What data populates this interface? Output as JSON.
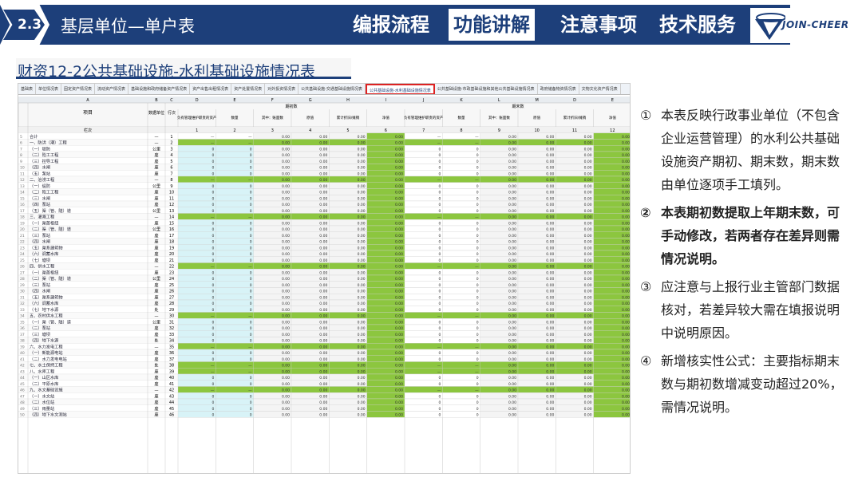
{
  "header": {
    "badge": "2.3",
    "title": "基层单位—单户表",
    "nav": [
      "编报流程",
      "功能讲解",
      "注意事项",
      "技术服务"
    ],
    "active_nav": 1,
    "logo": "JOIN-CHEER"
  },
  "section_title": "财资12-2公共基础设施-水利基础设施情况表",
  "tabs": [
    "基础表",
    "单位情况表",
    "固定资产情况表",
    "流动资产情况表",
    "基础设施和政府储备资产情况表",
    "资产出售出租情况表",
    "资产处置情况表",
    "对外投资情况表",
    "公共基础设施-交通基础设施情况表",
    "公共基础设施-水利基础设施情况表",
    "公共基础设施-市政基础设施和其他公共基础设施情况表",
    "政府储备物资情况表",
    "文物文化资产情况表"
  ],
  "selected_tab": 9,
  "col_letters": [
    "A",
    "B",
    "C",
    "D",
    "E",
    "F",
    "G",
    "H",
    "I",
    "J",
    "K",
    "L",
    "M"
  ],
  "col_group_labels": [
    "期初数",
    "期末数"
  ],
  "col_sub_labels": [
    "负有管理维护职责的资产",
    "数量",
    "其中：账面数",
    "原值",
    "累计折旧/摊销",
    "净值",
    "负有管理维护职责的资产",
    "数量",
    "其中：账面数",
    "原值",
    "累计折旧/摊销",
    "净值"
  ],
  "head_left": [
    "项目",
    "数据单位",
    "行次"
  ],
  "row_nums": [
    "栏次",
    "合计"
  ],
  "rows": [
    {
      "n": "5",
      "name": "合计",
      "unit": "—",
      "i": "1"
    },
    {
      "n": "6",
      "name": "一、防洪（潮）工程",
      "unit": "—",
      "i": "2",
      "band": true
    },
    {
      "n": "7",
      "name": "（一）堤防",
      "unit": "公里",
      "i": "3",
      "v": true
    },
    {
      "n": "8",
      "name": "（二）险工工程",
      "unit": "座",
      "i": "4",
      "v": true
    },
    {
      "n": "9",
      "name": "（三）控导工程",
      "unit": "座",
      "i": "5",
      "v": true
    },
    {
      "n": "10",
      "name": "（四）水闸",
      "unit": "座",
      "i": "6",
      "v": true
    },
    {
      "n": "11",
      "name": "（五）泵站",
      "unit": "座",
      "i": "7",
      "v": true
    },
    {
      "n": "12",
      "name": "二、治涝工程",
      "unit": "—",
      "i": "8",
      "band": true
    },
    {
      "n": "13",
      "name": "（一）堤防",
      "unit": "公里",
      "i": "9",
      "v": true
    },
    {
      "n": "14",
      "name": "（二）险工工程",
      "unit": "座",
      "i": "10",
      "v": true
    },
    {
      "n": "15",
      "name": "（三）水闸",
      "unit": "座",
      "i": "11",
      "v": true
    },
    {
      "n": "16",
      "name": "（四）泵站",
      "unit": "座",
      "i": "12",
      "v": true
    },
    {
      "n": "17",
      "name": "（五）渠（管、隧）道",
      "unit": "公里",
      "i": "13",
      "v": true
    },
    {
      "n": "18",
      "name": "三、灌溉工程",
      "unit": "—",
      "i": "14",
      "band": true
    },
    {
      "n": "19",
      "name": "（一）渠首枢纽",
      "unit": "座",
      "i": "15",
      "v": true
    },
    {
      "n": "20",
      "name": "（二）渠（管、隧）道",
      "unit": "公里",
      "i": "16",
      "v": true
    },
    {
      "n": "21",
      "name": "（三）泵站",
      "unit": "座",
      "i": "17",
      "v": true
    },
    {
      "n": "22",
      "name": "（四）水闸",
      "unit": "座",
      "i": "18",
      "v": true
    },
    {
      "n": "23",
      "name": "（五）渠系建筑物",
      "unit": "座",
      "i": "19",
      "v": true
    },
    {
      "n": "24",
      "name": "（六）调蓄水库",
      "unit": "座",
      "i": "20",
      "v": true
    },
    {
      "n": "25",
      "name": "（七）塘坝",
      "unit": "座",
      "i": "21",
      "v": true
    },
    {
      "n": "26",
      "name": "四、供水工程",
      "unit": "—",
      "i": "22",
      "band": true
    },
    {
      "n": "27",
      "name": "（一）渠首枢纽",
      "unit": "座",
      "i": "23",
      "v": true
    },
    {
      "n": "28",
      "name": "（二）渠（管、隧）道",
      "unit": "公里",
      "i": "24",
      "v": true
    },
    {
      "n": "29",
      "name": "（三）泵站",
      "unit": "座",
      "i": "25",
      "v": true
    },
    {
      "n": "30",
      "name": "（四）水闸",
      "unit": "座",
      "i": "26",
      "v": true
    },
    {
      "n": "31",
      "name": "（五）渠系建筑物",
      "unit": "座",
      "i": "27",
      "v": true
    },
    {
      "n": "32",
      "name": "（六）调蓄水库",
      "unit": "座",
      "i": "28",
      "v": true
    },
    {
      "n": "33",
      "name": "（七）地下水源",
      "unit": "处",
      "i": "29",
      "v": true
    },
    {
      "n": "34",
      "name": "五、农村供水工程",
      "unit": "—",
      "i": "30",
      "band": true
    },
    {
      "n": "35",
      "name": "（一）渠（管、隧）道",
      "unit": "公里",
      "i": "31",
      "v": true
    },
    {
      "n": "36",
      "name": "（二）泵站",
      "unit": "座",
      "i": "32",
      "v": true
    },
    {
      "n": "37",
      "name": "（三）塘坝",
      "unit": "座",
      "i": "33",
      "v": true
    },
    {
      "n": "38",
      "name": "（四）地下水源",
      "unit": "处",
      "i": "34",
      "v": true
    },
    {
      "n": "39",
      "name": "六、水力发电工程",
      "unit": "—",
      "i": "35",
      "band": true
    },
    {
      "n": "40",
      "name": "（一）新能源电站",
      "unit": "座",
      "i": "36",
      "v": true
    },
    {
      "n": "41",
      "name": "（二）水力发电电站",
      "unit": "座",
      "i": "37",
      "v": true
    },
    {
      "n": "42",
      "name": "七、水土保持工程",
      "unit": "处",
      "i": "38",
      "band": true
    },
    {
      "n": "43",
      "name": "八、水库工程",
      "unit": "座",
      "i": "39",
      "band": true
    },
    {
      "n": "44",
      "name": "（一）山区水库",
      "unit": "座",
      "i": "40",
      "v": true
    },
    {
      "n": "45",
      "name": "（二）平原水库",
      "unit": "座",
      "i": "41",
      "v": true
    },
    {
      "n": "46",
      "name": "九、水文基础设施",
      "unit": "—",
      "i": "42",
      "band": true
    },
    {
      "n": "47",
      "name": "（一）水文站",
      "unit": "座",
      "i": "43",
      "v": true
    },
    {
      "n": "48",
      "name": "（二）水位站",
      "unit": "座",
      "i": "44",
      "v": true
    },
    {
      "n": "49",
      "name": "（三）雨量站",
      "unit": "座",
      "i": "45",
      "v": true
    },
    {
      "n": "50",
      "name": "（四）地下水文测站",
      "unit": "座",
      "i": "46",
      "v": true
    }
  ],
  "zero": "0",
  "zero2": "0.00",
  "dash": "—",
  "notes": [
    {
      "n": "①",
      "text": "本表反映行政事业单位（不包含企业运营管理）的水利公共基础设施资产期初、期末数，期末数由单位逐项手工填列。",
      "bold": false
    },
    {
      "n": "②",
      "text": "本表期初数提取上年期末数，可手动修改，若两者存在差异则需情况说明。",
      "bold": true
    },
    {
      "n": "③",
      "text": "应注意与上报行业主管部门数据核对，若差异较大需在填报说明中说明原因。",
      "bold": false
    },
    {
      "n": "④",
      "text": "新增核实性公式：主要指标期末数与期初数增减变动超过20%，需情况说明。",
      "bold": false
    }
  ]
}
